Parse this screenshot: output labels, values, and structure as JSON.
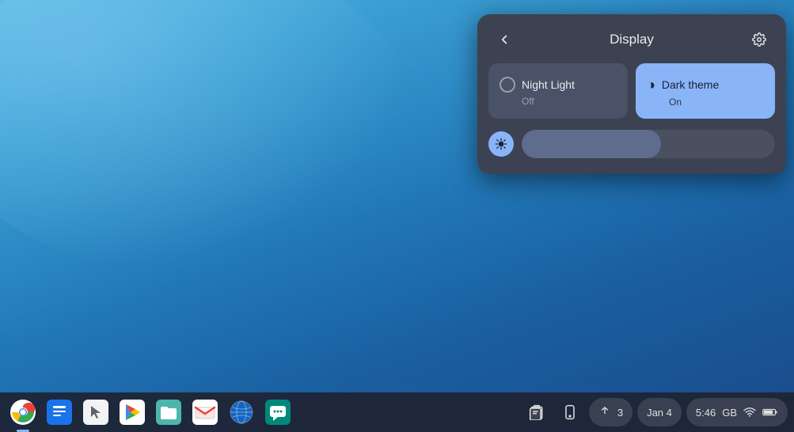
{
  "desktop": {
    "background": "blue gradient"
  },
  "display_panel": {
    "title": "Display",
    "back_button_label": "‹",
    "settings_button_label": "⚙",
    "night_light_card": {
      "label": "Night Light",
      "status": "Off",
      "active": false
    },
    "dark_theme_card": {
      "label": "Dark theme",
      "status": "On",
      "active": true
    },
    "brightness_slider": {
      "value": 55,
      "aria_label": "Brightness"
    }
  },
  "taskbar": {
    "apps": [
      {
        "name": "Chrome",
        "icon": "🌐",
        "active": true
      },
      {
        "name": "Docs",
        "icon": "📄",
        "active": false
      },
      {
        "name": "Cursor",
        "icon": "🖱️",
        "active": false
      },
      {
        "name": "Play Store",
        "icon": "▶",
        "active": false
      },
      {
        "name": "Files",
        "icon": "📁",
        "active": false
      },
      {
        "name": "Gmail",
        "icon": "✉",
        "active": false
      },
      {
        "name": "Earth",
        "icon": "🌍",
        "active": false
      },
      {
        "name": "Hangouts",
        "icon": "💬",
        "active": false
      }
    ],
    "system": {
      "clipboard_icon": "⧉",
      "phone_icon": "📱",
      "arrow_icon": "↑",
      "notification_count": "3",
      "date": "Jan 4",
      "time": "5:46",
      "network_label": "GB",
      "wifi_icon": "▾",
      "battery_icon": "🔋"
    }
  }
}
